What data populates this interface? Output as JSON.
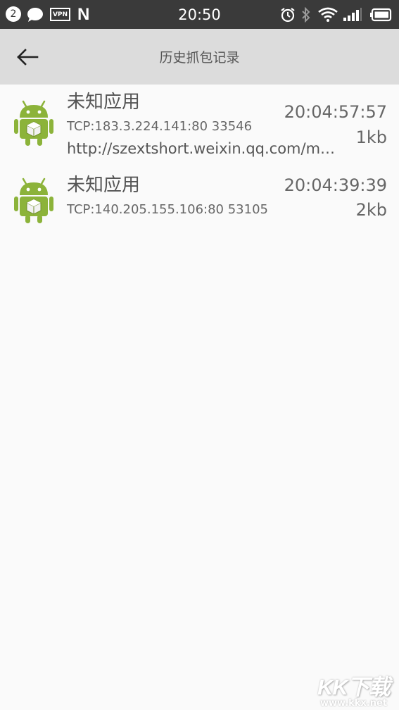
{
  "status_bar": {
    "notification_count": "2",
    "vpn_label": "VPN",
    "n_label": "N",
    "time": "20:50",
    "icons": [
      "chat-bubble-icon",
      "alarm-icon",
      "bluetooth-icon",
      "wifi-icon",
      "signal-icon",
      "battery-icon"
    ]
  },
  "header": {
    "title": "历史抓包记录",
    "back_icon": "arrow-left-icon",
    "background": "#dcdcdc"
  },
  "records": [
    {
      "app_name": "未知应用",
      "connection": "TCP:183.3.224.141:80 33546",
      "url": "http://szextshort.weixin.qq.com/mmtls/...",
      "time": "20:04:57:57",
      "size": "1kb",
      "icon": "android-app-icon"
    },
    {
      "app_name": "未知应用",
      "connection": "TCP:140.205.155.106:80 53105",
      "time": "20:04:39:39",
      "size": "2kb",
      "icon": "android-app-icon"
    }
  ],
  "watermark": {
    "logo": "KK下载",
    "url": "www.kkx.net"
  },
  "colors": {
    "status_bar": "#3a3a3a",
    "page_background": "#fafafa",
    "android_green": "#8cb33a"
  }
}
